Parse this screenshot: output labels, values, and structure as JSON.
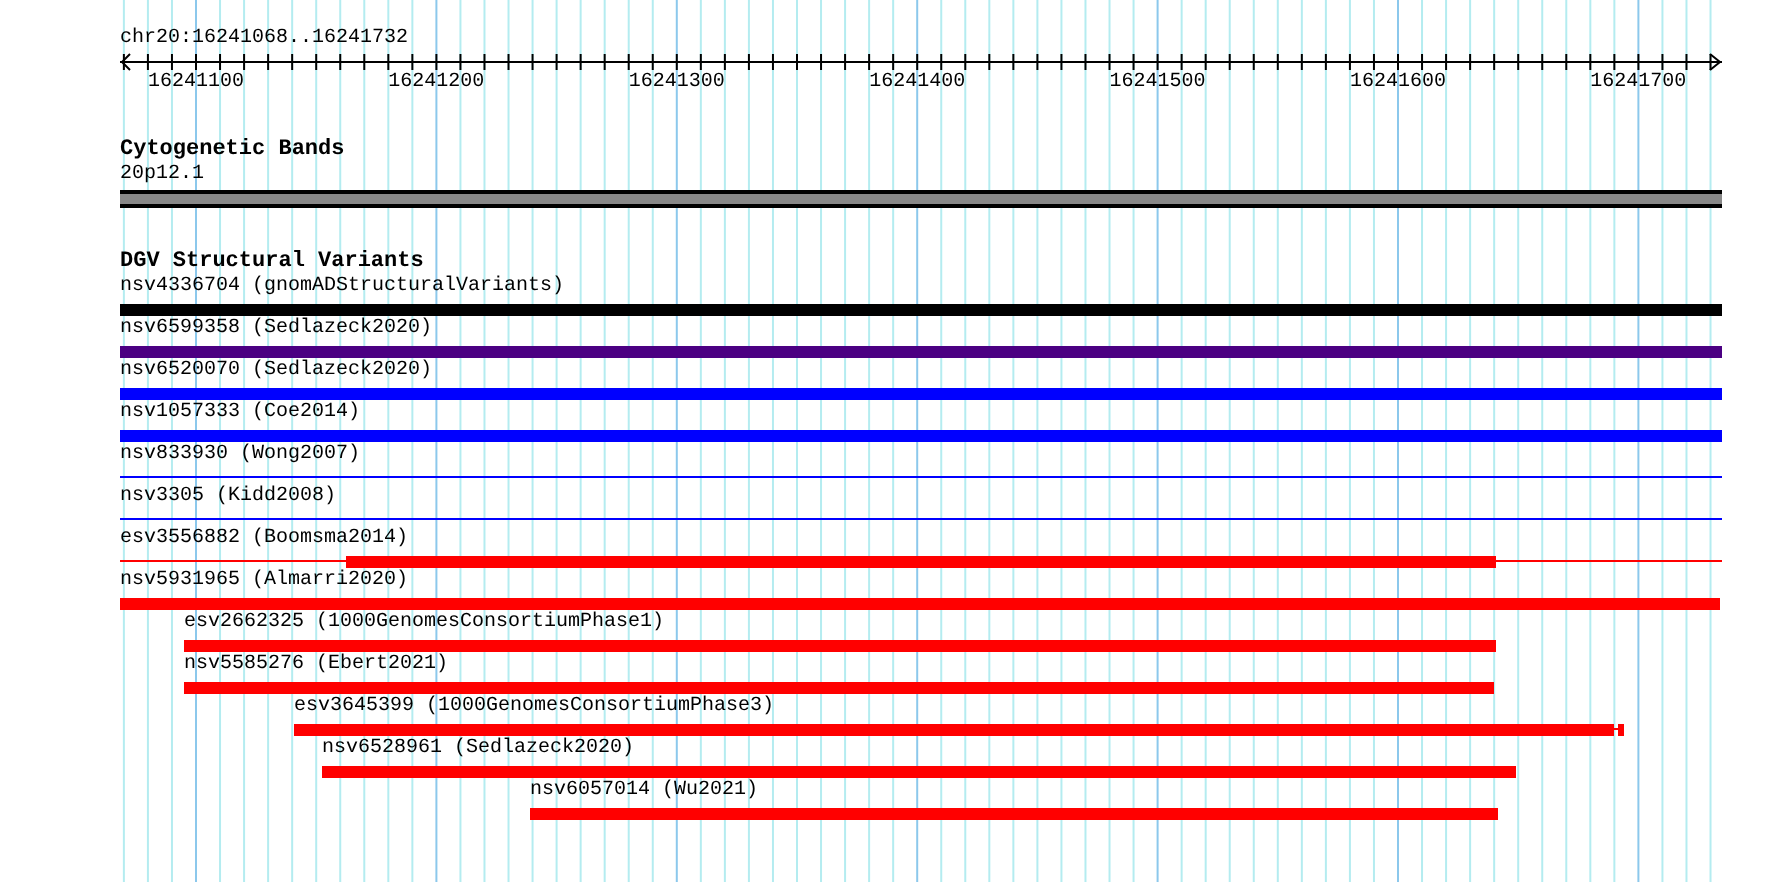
{
  "position": "chr20:16241068..16241732",
  "ruler": {
    "ticks": [
      "16241100",
      "16241200",
      "16241300",
      "16241400",
      "16241500",
      "16241600",
      "16241700"
    ]
  },
  "tracks": [
    {
      "kind": "bands",
      "title": "Cytogenetic Bands",
      "items": [
        {
          "label": "20p12.1"
        }
      ]
    },
    {
      "kind": "variants",
      "title": "DGV Structural Variants",
      "items": [
        {
          "label": "nsv4336704 (gnomADStructuralVariants)",
          "color": "#000000",
          "kind": "thick"
        },
        {
          "label": "nsv6599358 (Sedlazeck2020)",
          "color": "#4b0082",
          "kind": "thick"
        },
        {
          "label": "nsv6520070 (Sedlazeck2020)",
          "color": "#0000ff",
          "kind": "thick"
        },
        {
          "label": "nsv1057333 (Coe2014)",
          "color": "#0000ff",
          "kind": "thick"
        },
        {
          "label": "nsv833930 (Wong2007)",
          "color": "#0000ff",
          "kind": "thin"
        },
        {
          "label": "nsv3305 (Kidd2008)",
          "color": "#0000ff",
          "kind": "thin"
        },
        {
          "label": "esv3556882 (Boomsma2014)",
          "color": "#ff0000",
          "kind": "partial"
        },
        {
          "label": "nsv5931965 (Almarri2020)",
          "color": "#ff0000",
          "kind": "thick"
        },
        {
          "label": "esv2662325 (1000GenomesConsortiumPhase1)",
          "color": "#ff0000",
          "kind": "thick"
        },
        {
          "label": "nsv5585276 (Ebert2021)",
          "color": "#ff0000",
          "kind": "thick"
        },
        {
          "label": "esv3645399 (1000GenomesConsortiumPhase3)",
          "color": "#ff0000",
          "kind": "split"
        },
        {
          "label": "nsv6528961 (Sedlazeck2020)",
          "color": "#ff0000",
          "kind": "thick"
        },
        {
          "label": "nsv6057014 (Wu2021)",
          "color": "#ff0000",
          "kind": "thick"
        }
      ]
    }
  ]
}
